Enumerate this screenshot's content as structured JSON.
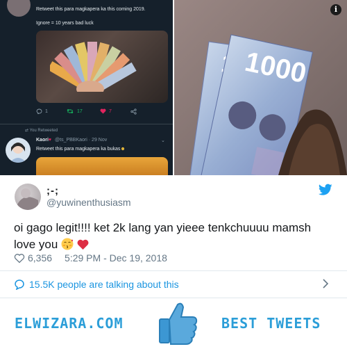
{
  "embedded_tweet_1": {
    "text_line_1": "Retweet this para magkapera ka this coming 2019.",
    "text_line_2": "Ignore = 10 years bad luck",
    "reply_count": "1",
    "retweet_count": "17",
    "like_count": "7"
  },
  "embedded_tweet_2": {
    "retweeted_label": "You Retweeted",
    "author_name": "Kaori",
    "author_handle": "@ts_PBBKaori",
    "date": "29 Nov",
    "text": "Retweet this para magkapera ka bukas"
  },
  "banknote_value": "1000",
  "tweet": {
    "display_name": ";-;",
    "handle": "@yuwinenthusiasm",
    "text": "oi gago legit!!!! ket 2k lang yan yieee tenkchuuuu mamsh love you",
    "like_count": "6,356",
    "timestamp": "5:29 PM - Dec 19, 2018",
    "talking_about": "15.5K people are talking about this"
  },
  "footer": {
    "brand": "ELWIZARA.COM",
    "tagline": "BEST TWEETS"
  },
  "colors": {
    "twitter_blue": "#1da1f2",
    "link_blue": "#1b95e0",
    "brand_blue": "#2c9ed8",
    "heart_red": "#e0245e"
  }
}
